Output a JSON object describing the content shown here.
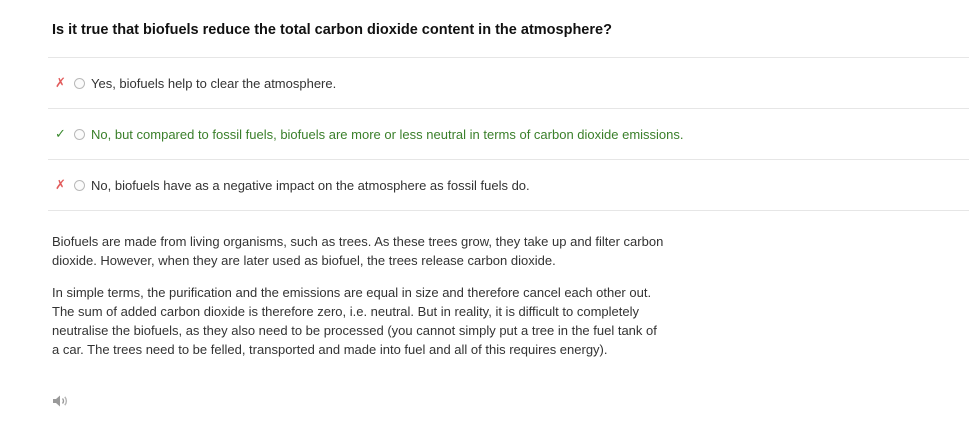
{
  "question": "Is it true that biofuels reduce the total carbon dioxide content in the atmosphere?",
  "options": [
    {
      "mark": "✗",
      "status": "incorrect",
      "text": "Yes, biofuels help to clear the atmosphere."
    },
    {
      "mark": "✓",
      "status": "correct",
      "text": "No, but compared to fossil fuels, biofuels are more or less neutral in terms of carbon dioxide emissions."
    },
    {
      "mark": "✗",
      "status": "incorrect",
      "text": "No, biofuels have as a negative impact on the atmosphere as fossil fuels do."
    }
  ],
  "explanation": {
    "paragraph1": "Biofuels are made from living organisms, such as trees. As these trees grow, they take up and filter carbon dioxide. However, when they are later used as biofuel, the trees release carbon dioxide.",
    "paragraph2": "In simple terms, the purification and the emissions are equal in size and therefore cancel each other out. The sum of added carbon dioxide is therefore zero, i.e. neutral. But in reality, it is difficult to completely neutralise the biofuels, as they also need to be processed (you cannot simply put a tree in the fuel tank of a car. The trees need to be felled, transported and made into fuel and all of this requires energy)."
  },
  "colors": {
    "correct": "#3a7f2a",
    "incorrect": "#e25b5b",
    "divider": "#e6e6e6"
  },
  "icons": {
    "audio": "speaker-icon"
  }
}
